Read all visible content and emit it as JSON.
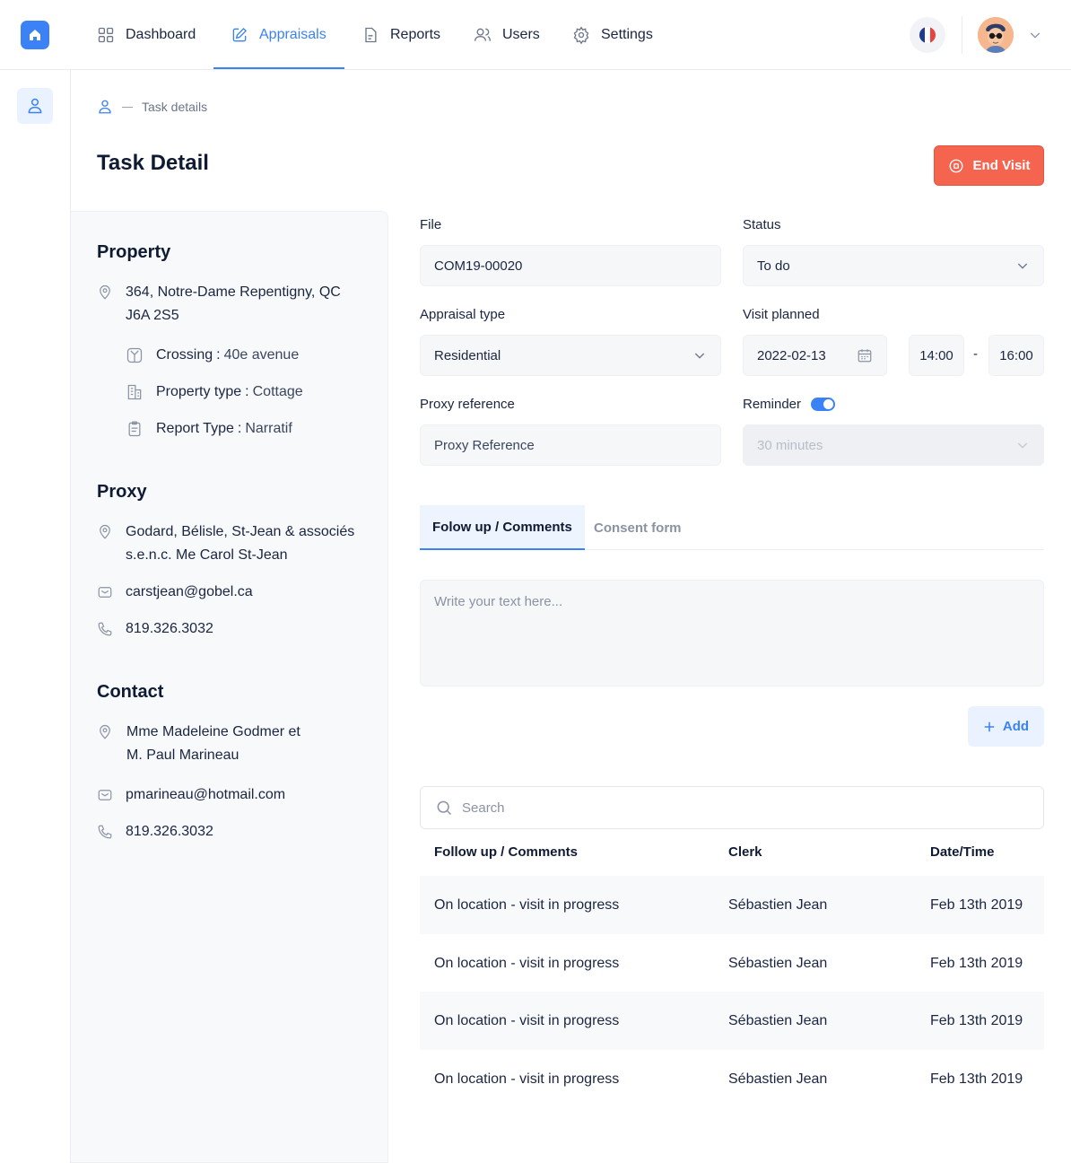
{
  "nav": {
    "items": [
      {
        "label": "Dashboard",
        "icon": "grid-icon"
      },
      {
        "label": "Appraisals",
        "icon": "edit-icon",
        "active": true
      },
      {
        "label": "Reports",
        "icon": "document-icon"
      },
      {
        "label": "Users",
        "icon": "users-icon"
      },
      {
        "label": "Settings",
        "icon": "gear-icon"
      }
    ]
  },
  "breadcrumb": {
    "current": "Task details"
  },
  "page": {
    "title": "Task Detail",
    "end_visit_label": "End Visit"
  },
  "property": {
    "title": "Property",
    "address_line1": "364, Notre-Dame Repentigny, QC",
    "address_line2": "J6A 2S5",
    "crossing_label": "Crossing",
    "crossing_value": "40e avenue",
    "property_type_label": "Property type",
    "property_type_value": "Cottage",
    "report_type_label": "Report Type",
    "report_type_value": "Narratif",
    "separator": ":"
  },
  "proxy": {
    "title": "Proxy",
    "name_line1": "Godard, Bélisle, St-Jean & associés",
    "name_line2": "s.e.n.c. Me Carol St-Jean",
    "email": "carstjean@gobel.ca",
    "phone": "819.326.3032"
  },
  "contact": {
    "title": "Contact",
    "name_line1": "Mme Madeleine Godmer et",
    "name_line2": "M. Paul Marineau",
    "email": "pmarineau@hotmail.com",
    "phone": "819.326.3032"
  },
  "form": {
    "file_label": "File",
    "file_value": "COM19-00020",
    "status_label": "Status",
    "status_value": "To do",
    "appraisal_type_label": "Appraisal type",
    "appraisal_type_value": "Residential",
    "visit_planned_label": "Visit planned",
    "visit_date": "2022-02-13",
    "visit_start": "14:00",
    "visit_sep": "-",
    "visit_end": "16:00",
    "proxy_reference_label": "Proxy reference",
    "proxy_reference_placeholder": "Proxy Reference",
    "reminder_label": "Reminder",
    "reminder_on": true,
    "reminder_value": "30 minutes"
  },
  "tabs": [
    {
      "label": "Folow up / Comments",
      "active": true
    },
    {
      "label": "Consent form",
      "active": false
    }
  ],
  "comment": {
    "placeholder": "Write your text here...",
    "add_label": "Add"
  },
  "search": {
    "placeholder": "Search"
  },
  "table": {
    "headers": [
      "Follow up / Comments",
      "Clerk",
      "Date/Time"
    ],
    "rows": [
      [
        "On location - visit in progress",
        "Sébastien Jean",
        "Feb 13th 2019"
      ],
      [
        "On location - visit in progress",
        "Sébastien Jean",
        "Feb 13th 2019"
      ],
      [
        "On location - visit in progress",
        "Sébastien Jean",
        "Feb 13th 2019"
      ],
      [
        "On location - visit in progress",
        "Sébastien Jean",
        "Feb 13th 2019"
      ]
    ]
  },
  "colors": {
    "accent": "#3b82f6",
    "danger": "#f4644f",
    "panel": "#f8f9fb"
  }
}
